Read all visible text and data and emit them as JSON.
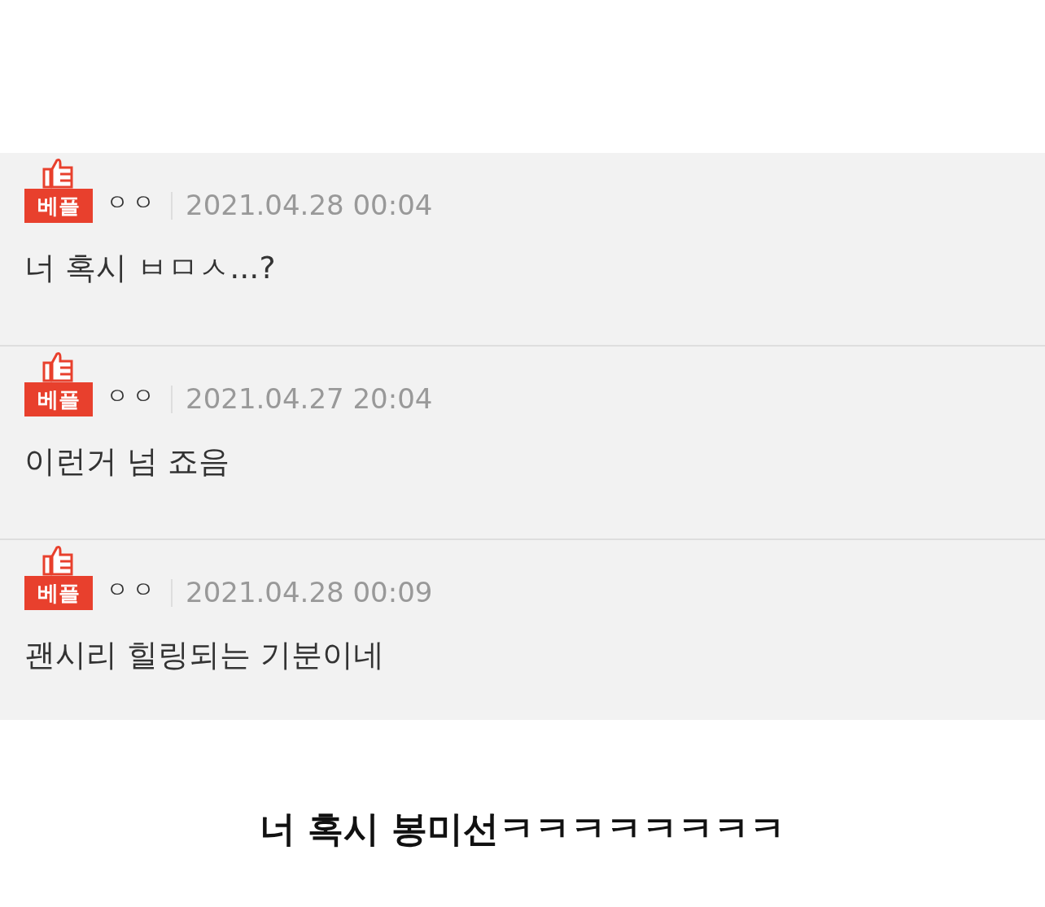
{
  "comments": [
    {
      "badge": "베플",
      "author": "ㅇㅇ",
      "date": "2021.04.28 00:04",
      "text": "너 혹시 ㅂㅁㅅ...?"
    },
    {
      "badge": "베플",
      "author": "ㅇㅇ",
      "date": "2021.04.27 20:04",
      "text": "이런거 넘 죠음"
    },
    {
      "badge": "베플",
      "author": "ㅇㅇ",
      "date": "2021.04.28 00:09",
      "text": "괜시리 힐링되는 기분이네"
    }
  ],
  "caption": "너 혹시 봉미선ㅋㅋㅋㅋㅋㅋㅋㅋ"
}
